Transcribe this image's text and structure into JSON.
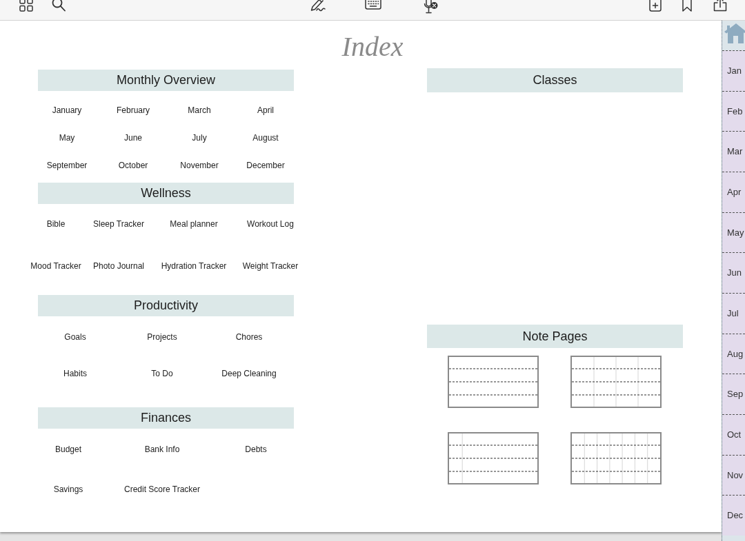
{
  "page": {
    "title": "Index",
    "index_sections": [
      {
        "title": "Monthly Overview",
        "rows": [
          [
            "January",
            "February",
            "March",
            "April"
          ],
          [
            "May",
            "June",
            "July",
            "August"
          ],
          [
            "September",
            "October",
            "November",
            "December"
          ]
        ]
      },
      {
        "title": "Wellness",
        "rows": [
          [
            "Bible",
            "Sleep Tracker",
            "Meal planner",
            "Workout Log"
          ],
          [
            "Mood Tracker",
            "Photo Journal",
            "Hydration Tracker",
            "Weight Tracker"
          ]
        ]
      },
      {
        "title": "Productivity",
        "rows": [
          [
            "Goals",
            "Projects",
            "Chores"
          ],
          [
            "Habits",
            "To Do",
            "Deep Cleaning"
          ]
        ]
      },
      {
        "title": "Finances",
        "rows": [
          [
            "Budget",
            "Bank Info",
            "Debts"
          ],
          [
            "Savings",
            "Credit Score Tracker"
          ]
        ]
      }
    ],
    "classes": {
      "title": "Classes"
    },
    "note_pages": {
      "title": "Note Pages",
      "templates": [
        {
          "kind": "lined"
        },
        {
          "kind": "columns"
        },
        {
          "kind": "margin"
        },
        {
          "kind": "grid"
        }
      ]
    }
  },
  "side_tabs": [
    {
      "label": "Jan"
    },
    {
      "label": "Feb"
    },
    {
      "label": "Mar"
    },
    {
      "label": "Apr"
    },
    {
      "label": "May"
    },
    {
      "label": "Jun"
    },
    {
      "label": "Jul"
    },
    {
      "label": "Aug"
    },
    {
      "label": "Sep"
    },
    {
      "label": "Oct"
    },
    {
      "label": "Nov"
    },
    {
      "label": "Dec"
    }
  ]
}
